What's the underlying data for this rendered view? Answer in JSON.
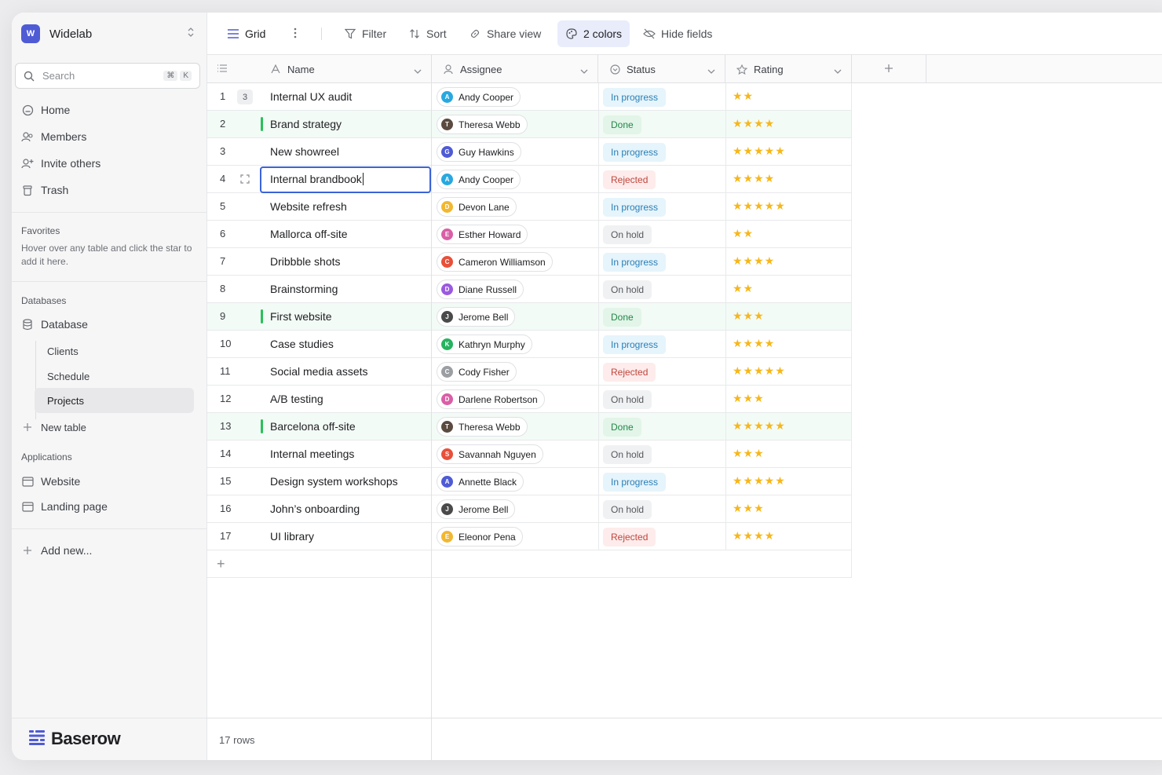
{
  "workspace": {
    "logo_letter": "W",
    "name": "Widelab"
  },
  "search": {
    "placeholder": "Search",
    "kbd1": "⌘",
    "kbd2": "K"
  },
  "nav": [
    {
      "label": "Home",
      "icon": "home-icon"
    },
    {
      "label": "Members",
      "icon": "members-icon"
    },
    {
      "label": "Invite others",
      "icon": "invite-icon"
    },
    {
      "label": "Trash",
      "icon": "trash-icon"
    }
  ],
  "favorites": {
    "title": "Favorites",
    "hint": "Hover over any table and click the star to add it here."
  },
  "databases": {
    "title": "Databases",
    "database_label": "Database",
    "tables": [
      "Clients",
      "Schedule",
      "Projects"
    ],
    "active_table": "Projects",
    "new_table": "New table"
  },
  "applications": {
    "title": "Applications",
    "items": [
      "Website",
      "Landing page"
    ]
  },
  "add_new": "Add new...",
  "brand": "Baserow",
  "toolbar": {
    "grid": "Grid",
    "filter": "Filter",
    "sort": "Sort",
    "share": "Share view",
    "colors": "2 colors",
    "hide": "Hide fields"
  },
  "columns": {
    "name": "Name",
    "assignee": "Assignee",
    "status": "Status",
    "rating": "Rating"
  },
  "colors": {
    "accent": "#4f5bd5",
    "star": "#f6b71c",
    "done_bar": "#2bbf5b"
  },
  "rows": [
    {
      "n": "1",
      "name": "Internal UX audit",
      "assignee": "Andy Cooper",
      "initial": "A",
      "av": "#29a8e0",
      "status": "In progress",
      "stars": "★★"
    },
    {
      "n": "2",
      "name": "Brand strategy",
      "assignee": "Theresa Webb",
      "initial": "T",
      "av": "#5b4a3f",
      "status": "Done",
      "stars": "★★★★"
    },
    {
      "n": "3",
      "name": "New showreel",
      "assignee": "Guy Hawkins",
      "initial": "G",
      "av": "#4f5bd5",
      "status": "In progress",
      "stars": "★★★★★"
    },
    {
      "n": "4",
      "name": "Internal brandbook",
      "assignee": "Andy Cooper",
      "initial": "A",
      "av": "#29a8e0",
      "status": "Rejected",
      "stars": "★★★★"
    },
    {
      "n": "5",
      "name": "Website refresh",
      "assignee": "Devon Lane",
      "initial": "D",
      "av": "#f2b731",
      "status": "In progress",
      "stars": "★★★★★"
    },
    {
      "n": "6",
      "name": "Mallorca off-site",
      "assignee": "Esther Howard",
      "initial": "E",
      "av": "#d95fa6",
      "status": "On hold",
      "stars": "★★"
    },
    {
      "n": "7",
      "name": "Dribbble shots",
      "assignee": "Cameron Williamson",
      "initial": "C",
      "av": "#e8503a",
      "status": "In progress",
      "stars": "★★★★"
    },
    {
      "n": "8",
      "name": "Brainstorming",
      "assignee": "Diane Russell",
      "initial": "D",
      "av": "#9a5ae0",
      "status": "On hold",
      "stars": "★★"
    },
    {
      "n": "9",
      "name": "First website",
      "assignee": "Jerome Bell",
      "initial": "J",
      "av": "#4a4a4a",
      "status": "Done",
      "stars": "★★★"
    },
    {
      "n": "10",
      "name": "Case studies",
      "assignee": "Kathryn Murphy",
      "initial": "K",
      "av": "#27b35f",
      "status": "In progress",
      "stars": "★★★★"
    },
    {
      "n": "11",
      "name": "Social media assets",
      "assignee": "Cody Fisher",
      "initial": "C",
      "av": "#9b9ea3",
      "status": "Rejected",
      "stars": "★★★★★"
    },
    {
      "n": "12",
      "name": "A/B testing",
      "assignee": "Darlene Robertson",
      "initial": "D",
      "av": "#d95fa6",
      "status": "On hold",
      "stars": "★★★"
    },
    {
      "n": "13",
      "name": "Barcelona off-site",
      "assignee": "Theresa Webb",
      "initial": "T",
      "av": "#5b4a3f",
      "status": "Done",
      "stars": "★★★★★"
    },
    {
      "n": "14",
      "name": "Internal meetings",
      "assignee": "Savannah Nguyen",
      "initial": "S",
      "av": "#e8503a",
      "status": "On hold",
      "stars": "★★★"
    },
    {
      "n": "15",
      "name": "Design system workshops",
      "assignee": "Annette Black",
      "initial": "A",
      "av": "#4f5bd5",
      "status": "In progress",
      "stars": "★★★★★"
    },
    {
      "n": "16",
      "name": "John’s onboarding",
      "assignee": "Jerome Bell",
      "initial": "J",
      "av": "#4a4a4a",
      "status": "On hold",
      "stars": "★★★"
    },
    {
      "n": "17",
      "name": "UI library",
      "assignee": "Eleonor Pena",
      "initial": "E",
      "av": "#f2b731",
      "status": "Rejected",
      "stars": "★★★★"
    }
  ],
  "row1_count_badge": "3",
  "footer": {
    "rows_count": "17 rows"
  }
}
